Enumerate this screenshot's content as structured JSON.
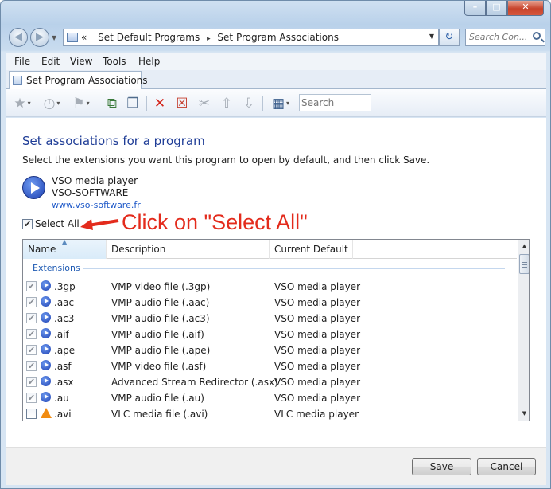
{
  "window": {
    "controls": {
      "minimize": "–",
      "maximize": "□",
      "close": "✕"
    }
  },
  "nav": {
    "back_glyph": "◀",
    "forward_glyph": "▶",
    "address": {
      "prefix": "«",
      "crumbs": [
        "Set Default Programs",
        "Set Program Associations"
      ],
      "separator": "▸"
    },
    "refresh_glyph": "↻",
    "search_placeholder": "Search Con..."
  },
  "menubar": {
    "items": [
      "File",
      "Edit",
      "View",
      "Tools",
      "Help"
    ]
  },
  "tab": {
    "label": "Set Program Associations"
  },
  "toolbar": {
    "buttons": [
      {
        "icon": "star-icon",
        "glyph": "★"
      },
      {
        "icon": "clock-icon",
        "glyph": "◷"
      },
      {
        "icon": "windows-flag-icon",
        "glyph": "⚑"
      },
      {
        "icon": "move-icon",
        "glyph": "⧉"
      },
      {
        "icon": "copy-icon",
        "glyph": "❐"
      },
      {
        "icon": "delete-icon",
        "glyph": "✕"
      },
      {
        "icon": "delete-selected-icon",
        "glyph": "☒"
      },
      {
        "icon": "cut-icon",
        "glyph": "✂"
      },
      {
        "icon": "arrow-up-icon",
        "glyph": "⇧"
      },
      {
        "icon": "arrow-down-icon",
        "glyph": "⇩"
      },
      {
        "icon": "view-grid-icon",
        "glyph": "▦"
      }
    ],
    "search_placeholder": "Search"
  },
  "page": {
    "heading": "Set associations for a program",
    "instruction": "Select the extensions you want this program to open by default, and then click Save.",
    "program": {
      "name": "VSO media player",
      "publisher": "VSO-SOFTWARE",
      "url": "www.vso-software.fr"
    },
    "select_all": {
      "label": "Select All",
      "checked": true
    },
    "annotation": {
      "text": "Click on \"Select All\"",
      "color": "#e32b1c"
    }
  },
  "list": {
    "columns": [
      "Name",
      "Description",
      "Current Default"
    ],
    "group_label": "Extensions",
    "rows": [
      {
        "checked": true,
        "icon": "vso",
        "name": ".3gp",
        "description": "VMP video file (.3gp)",
        "default": "VSO media player"
      },
      {
        "checked": true,
        "icon": "vso",
        "name": ".aac",
        "description": "VMP audio file (.aac)",
        "default": "VSO media player"
      },
      {
        "checked": true,
        "icon": "vso",
        "name": ".ac3",
        "description": "VMP audio file (.ac3)",
        "default": "VSO media player"
      },
      {
        "checked": true,
        "icon": "vso",
        "name": ".aif",
        "description": "VMP audio file (.aif)",
        "default": "VSO media player"
      },
      {
        "checked": true,
        "icon": "vso",
        "name": ".ape",
        "description": "VMP audio file (.ape)",
        "default": "VSO media player"
      },
      {
        "checked": true,
        "icon": "vso",
        "name": ".asf",
        "description": "VMP video file (.asf)",
        "default": "VSO media player"
      },
      {
        "checked": true,
        "icon": "vso",
        "name": ".asx",
        "description": "Advanced Stream Redirector (.asx)",
        "default": "VSO media player"
      },
      {
        "checked": true,
        "icon": "vso",
        "name": ".au",
        "description": "VMP audio file (.au)",
        "default": "VSO media player"
      },
      {
        "checked": false,
        "icon": "vlc",
        "name": ".avi",
        "description": "VLC media file (.avi)",
        "default": "VLC media player"
      }
    ]
  },
  "buttons": {
    "save": "Save",
    "cancel": "Cancel"
  }
}
